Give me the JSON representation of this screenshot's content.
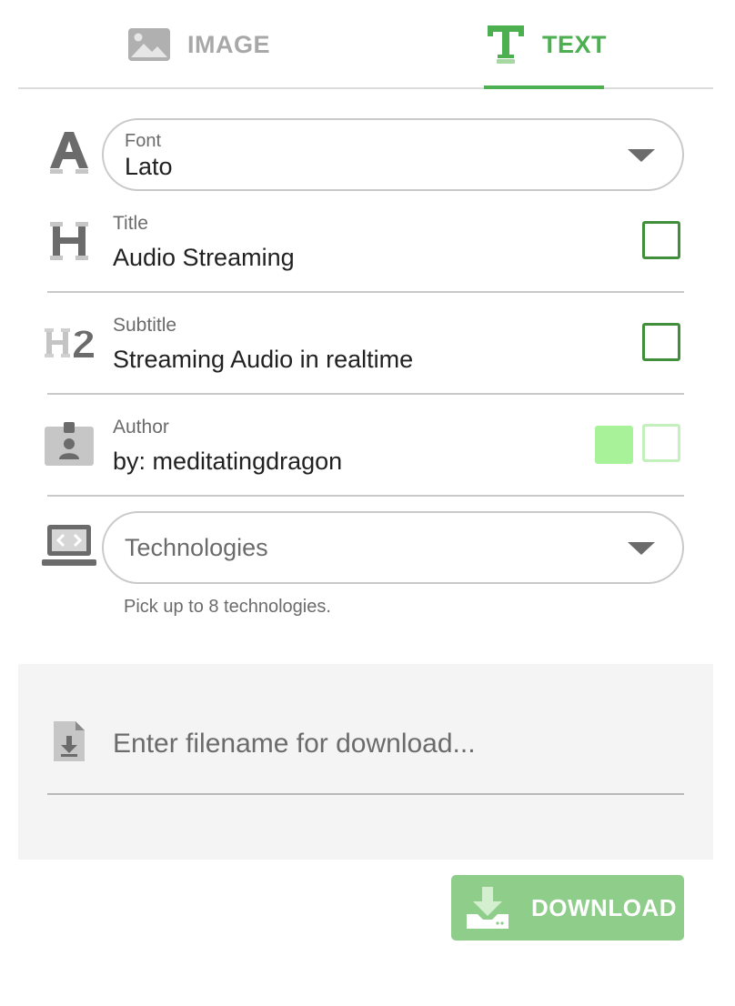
{
  "tabs": [
    {
      "label": "IMAGE",
      "icon": "image-icon",
      "active": false
    },
    {
      "label": "TEXT",
      "icon": "text-icon",
      "active": true
    }
  ],
  "font": {
    "label": "Font",
    "value": "Lato",
    "icon": "font-icon"
  },
  "title": {
    "label": "Title",
    "value": "Audio Streaming",
    "icon": "heading-icon",
    "checked": false
  },
  "subtitle": {
    "label": "Subtitle",
    "value": "Streaming Audio in realtime",
    "icon": "heading-2-icon",
    "checked": false
  },
  "author": {
    "label": "Author",
    "value": "by: meditatingdragon",
    "icon": "id-badge-icon",
    "swatch_colors": [
      "#a8f39a",
      "#ffffff"
    ]
  },
  "technologies": {
    "placeholder": "Technologies",
    "hint": "Pick up to 8 technologies.",
    "icon": "laptop-code-icon"
  },
  "download": {
    "filename_placeholder": "Enter filename for download...",
    "file_icon": "file-download-icon",
    "button_label": "DOWNLOAD",
    "button_icon": "download-tray-icon"
  },
  "colors": {
    "accent": "#4caf50",
    "checkbox_border": "#3f8f3a",
    "button_bg": "#8fcd8a",
    "inactive_gray": "#a8a8a8"
  }
}
